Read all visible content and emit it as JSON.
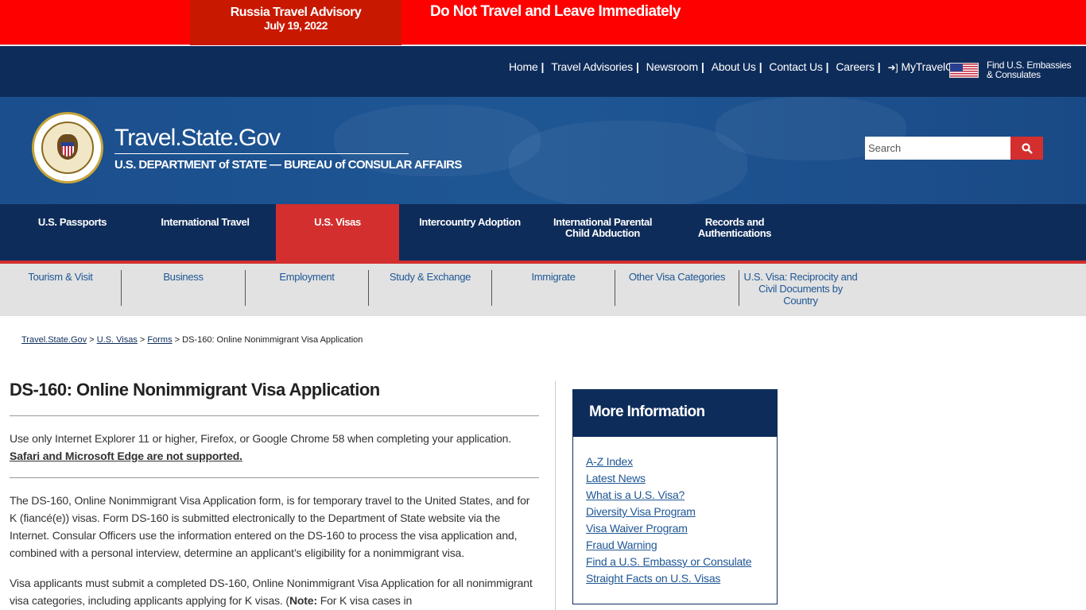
{
  "alert": {
    "title": "Russia Travel Advisory",
    "date": "July 19, 2022",
    "message": "Do Not Travel and Leave Immediately"
  },
  "utility_nav": {
    "items": [
      "Home",
      "Travel Advisories",
      "Newsroom",
      "About Us",
      "Contact Us",
      "Careers"
    ],
    "login": "MyTravelGov",
    "embassy_line1": "Find U.S. Embassies",
    "embassy_line2": "& Consulates"
  },
  "header": {
    "site_title": "Travel.State.Gov",
    "subtitle": "U.S. DEPARTMENT of STATE — BUREAU of CONSULAR AFFAIRS",
    "search_placeholder": "Search"
  },
  "main_nav": {
    "items": [
      "U.S. Passports",
      "International Travel",
      "U.S. Visas",
      "Intercountry Adoption",
      "International Parental Child Abduction",
      "Records and Authentications"
    ],
    "active": "U.S. Visas"
  },
  "sub_nav": {
    "items": [
      "Tourism & Visit",
      "Business",
      "Employment",
      "Study & Exchange",
      "Immigrate",
      "Other Visa Categories",
      "U.S. Visa: Reciprocity and Civil Documents by Country"
    ]
  },
  "breadcrumb": {
    "items": [
      "Travel.State.Gov",
      "U.S. Visas",
      "Forms"
    ],
    "current": "DS-160: Online Nonimmigrant Visa Application",
    "separator": ">"
  },
  "content": {
    "title": "DS-160: Online Nonimmigrant Visa Application",
    "browser_note": "Use only Internet Explorer 11 or higher, Firefox, or Google Chrome 58 when completing your application.",
    "browser_warning": "Safari and Microsoft Edge are not supported.",
    "para1": "The DS-160, Online Nonimmigrant Visa Application form, is for temporary travel to the United States, and for K (fiancé(e)) visas. Form DS-160 is submitted electronically to the Department of State website via the Internet. Consular Officers use the information entered on the DS-160 to process the visa application and, combined with a personal interview, determine an applicant’s eligibility for a nonimmigrant visa.",
    "para2_start": "Visa applicants must submit a completed DS-160, Online Nonimmigrant Visa Application for all nonimmigrant visa categories, including applicants applying for K visas. (",
    "para2_note_label": "Note:",
    "para2_rest": "  For K visa cases in"
  },
  "sidebar": {
    "heading": "More Information",
    "links": [
      "A-Z Index",
      "Latest News",
      "What is a U.S. Visa?",
      "Diversity Visa Program",
      "Visa Waiver Program",
      "Fraud Warning",
      "Find a U.S. Embassy or Consulate",
      "Straight Facts on U.S. Visas"
    ]
  },
  "colors": {
    "alert_red": "#ff0000",
    "navy": "#0e2c5a",
    "accent_red": "#d32f2f",
    "link_blue": "#1e5694"
  }
}
